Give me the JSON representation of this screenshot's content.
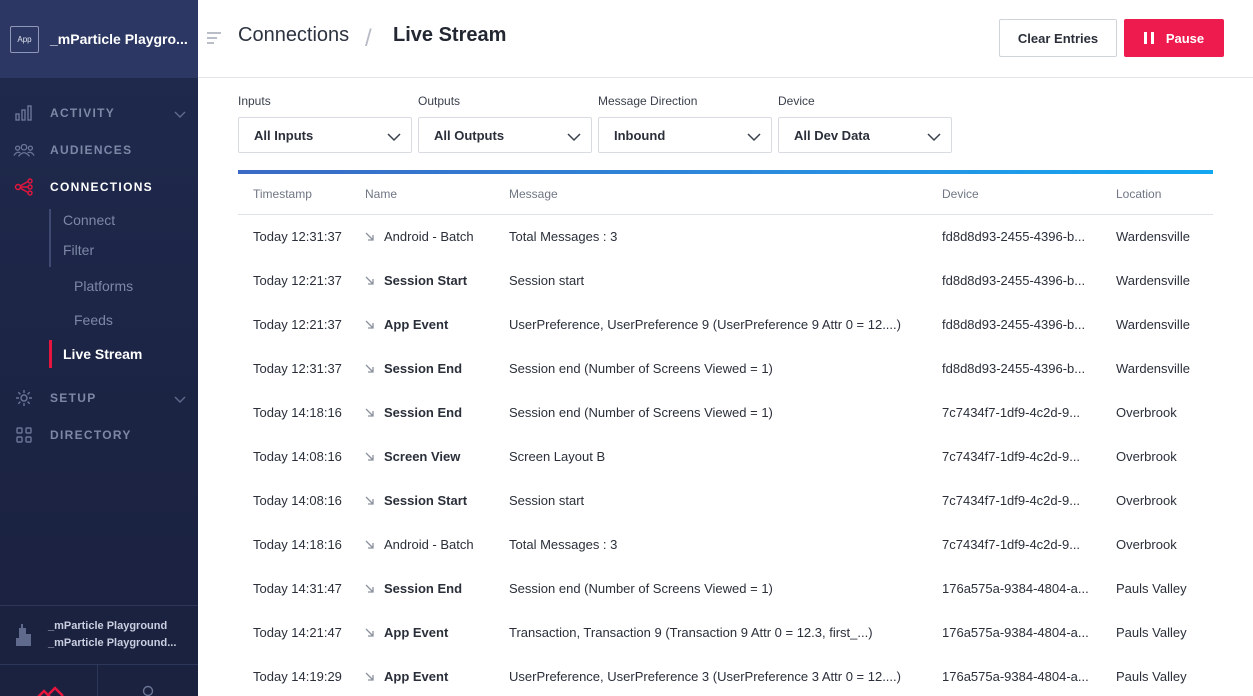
{
  "sidebar": {
    "app_badge": "App",
    "app_name": "_mParticle Playgro...",
    "nav": [
      {
        "label": "ACTIVITY",
        "icon": "bar-chart-icon"
      },
      {
        "label": "AUDIENCES",
        "icon": "people-icon"
      },
      {
        "label": "CONNECTIONS",
        "icon": "connections-icon"
      },
      {
        "label": "SETUP",
        "icon": "gear-icon"
      },
      {
        "label": "DIRECTORY",
        "icon": "grid-icon"
      }
    ],
    "sub": {
      "connect": "Connect",
      "filter": "Filter",
      "platforms": "Platforms",
      "feeds": "Feeds",
      "live_stream": "Live Stream"
    },
    "account": {
      "line1": "_mParticle Playground",
      "line2": "_mParticle Playground..."
    },
    "accent_color": "#e5153e"
  },
  "header": {
    "crumb1": "Connections",
    "separator": "/",
    "crumb2": "Live Stream",
    "clear_label": "Clear Entries",
    "pause_label": "Pause",
    "pause_color": "#ed1b4e"
  },
  "filters": [
    {
      "label": "Inputs",
      "value": "All Inputs"
    },
    {
      "label": "Outputs",
      "value": "All Outputs"
    },
    {
      "label": "Message Direction",
      "value": "Inbound"
    },
    {
      "label": "Device",
      "value": "All Dev Data"
    }
  ],
  "table": {
    "columns": [
      "Timestamp",
      "Name",
      "Message",
      "Device",
      "Location"
    ],
    "rows": [
      {
        "timestamp": "Today 12:31:37",
        "name": "Android - Batch",
        "bold": false,
        "message": "Total Messages : 3",
        "device": "fd8d8d93-2455-4396-b...",
        "location": "Wardensville"
      },
      {
        "timestamp": "Today 12:21:37",
        "name": "Session Start",
        "bold": true,
        "message": "Session start",
        "device": "fd8d8d93-2455-4396-b...",
        "location": "Wardensville"
      },
      {
        "timestamp": "Today 12:21:37",
        "name": "App Event",
        "bold": true,
        "message": "UserPreference, UserPreference 9 (UserPreference 9 Attr 0 = 12....)",
        "device": "fd8d8d93-2455-4396-b...",
        "location": "Wardensville"
      },
      {
        "timestamp": "Today 12:31:37",
        "name": "Session End",
        "bold": true,
        "message": "Session end (Number of Screens Viewed = 1)",
        "device": "fd8d8d93-2455-4396-b...",
        "location": "Wardensville"
      },
      {
        "timestamp": "Today 14:18:16",
        "name": "Session End",
        "bold": true,
        "message": "Session end (Number of Screens Viewed = 1)",
        "device": "7c7434f7-1df9-4c2d-9...",
        "location": "Overbrook"
      },
      {
        "timestamp": "Today 14:08:16",
        "name": "Screen View",
        "bold": true,
        "message": "Screen Layout B",
        "device": "7c7434f7-1df9-4c2d-9...",
        "location": "Overbrook"
      },
      {
        "timestamp": "Today 14:08:16",
        "name": "Session Start",
        "bold": true,
        "message": "Session start",
        "device": "7c7434f7-1df9-4c2d-9...",
        "location": "Overbrook"
      },
      {
        "timestamp": "Today 14:18:16",
        "name": "Android - Batch",
        "bold": false,
        "message": "Total Messages : 3",
        "device": "7c7434f7-1df9-4c2d-9...",
        "location": "Overbrook"
      },
      {
        "timestamp": "Today 14:31:47",
        "name": "Session End",
        "bold": true,
        "message": "Session end (Number of Screens Viewed = 1)",
        "device": "176a575a-9384-4804-a...",
        "location": "Pauls Valley"
      },
      {
        "timestamp": "Today 14:21:47",
        "name": "App Event",
        "bold": true,
        "message": "Transaction, Transaction 9 (Transaction 9 Attr 0 = 12.3, first_...)",
        "device": "176a575a-9384-4804-a...",
        "location": "Pauls Valley"
      },
      {
        "timestamp": "Today 14:19:29",
        "name": "App Event",
        "bold": true,
        "message": "UserPreference, UserPreference 3 (UserPreference 3 Attr 0 = 12....)",
        "device": "176a575a-9384-4804-a...",
        "location": "Pauls Valley"
      }
    ]
  }
}
